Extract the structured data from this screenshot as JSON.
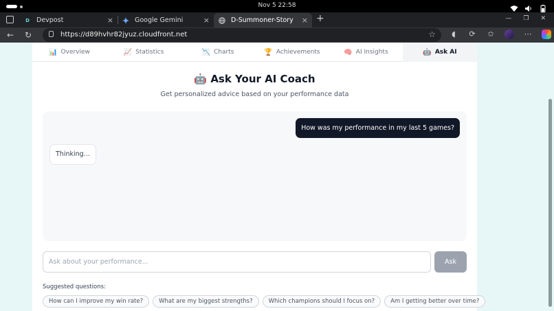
{
  "system": {
    "clock": "Nov 5  22:58"
  },
  "browser": {
    "tabs": [
      {
        "label": "Devpost",
        "favicon": "D"
      },
      {
        "label": "Google Gemini",
        "favicon": "gemini-icon"
      },
      {
        "label": "D-Summoner-Story",
        "favicon": "globe-icon",
        "active": true
      }
    ],
    "url": "https://d89hvhr82jyuz.cloudfront.net"
  },
  "page": {
    "nav": [
      {
        "emoji": "📊",
        "label": "Overview"
      },
      {
        "emoji": "📈",
        "label": "Statistics"
      },
      {
        "emoji": "📉",
        "label": "Charts"
      },
      {
        "emoji": "🏆",
        "label": "Achievements"
      },
      {
        "emoji": "🧠",
        "label": "AI Insights"
      },
      {
        "emoji": "🤖",
        "label": "Ask AI",
        "active": true
      }
    ],
    "title": "🤖 Ask Your AI Coach",
    "subtitle": "Get personalized advice based on your performance data",
    "chat": {
      "user_message": "How was my performance in my last 5 games?",
      "bot_message": "Thinking..."
    },
    "input": {
      "placeholder": "Ask about your performance...",
      "value": ""
    },
    "ask_button": "Ask",
    "suggested_label": "Suggested questions:",
    "suggestions": [
      "How can I improve my win rate?",
      "What are my biggest strengths?",
      "Which champions should I focus on?",
      "Am I getting better over time?"
    ]
  },
  "colors": {
    "accent_dark": "#111827",
    "page_bg": "#e7f6f6",
    "button_disabled": "#9ca3af"
  }
}
